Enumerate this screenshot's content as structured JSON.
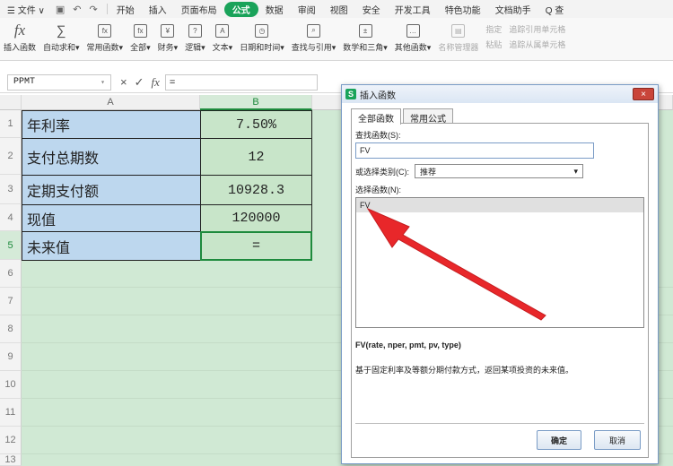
{
  "menu": {
    "file": "☰ 文件 ∨",
    "items": [
      "开始",
      "插入",
      "页面布局",
      "公式",
      "数据",
      "审阅",
      "视图",
      "安全",
      "开发工具",
      "特色功能",
      "文档助手"
    ],
    "active": "公式",
    "search": "Q 查"
  },
  "ribbon": {
    "buttons": [
      {
        "label": "插入函数",
        "icon": "fx-icon"
      },
      {
        "label": "自动求和▾",
        "icon": "sigma-icon"
      },
      {
        "label": "常用函数▾",
        "icon": "function-icon"
      },
      {
        "label": "全部▾",
        "icon": "function-icon"
      },
      {
        "label": "财务▾",
        "icon": "yen-icon"
      },
      {
        "label": "逻辑▾",
        "icon": "question-icon"
      },
      {
        "label": "文本▾",
        "icon": "text-icon"
      },
      {
        "label": "日期和时间▾",
        "icon": "clock-icon"
      },
      {
        "label": "查找与引用▾",
        "icon": "lookup-icon"
      },
      {
        "label": "数学和三角▾",
        "icon": "math-icon"
      },
      {
        "label": "其他函数▾",
        "icon": "more-icon"
      },
      {
        "label": "名称管理器",
        "icon": "name-manager-icon"
      }
    ],
    "small": [
      "指定",
      "粘贴",
      "追踪引用单元格",
      "追踪从属单元格"
    ]
  },
  "formula_bar": {
    "name_box": "PPMT",
    "cancel": "×",
    "confirm": "✓",
    "fx": "fx",
    "value": "="
  },
  "sheet": {
    "columns": [
      "A",
      "B"
    ],
    "rows": [
      "1",
      "2",
      "3",
      "4",
      "5",
      "6",
      "7",
      "8",
      "9",
      "10",
      "11",
      "12",
      "13"
    ],
    "data": [
      {
        "label": "年利率",
        "value": "7.50%"
      },
      {
        "label": "支付总期数",
        "value": "12"
      },
      {
        "label": "定期支付额",
        "value": "10928.3"
      },
      {
        "label": "现值",
        "value": "120000"
      },
      {
        "label": "未来值",
        "value": "="
      }
    ]
  },
  "dialog": {
    "title": "插入函数",
    "close": "×",
    "tabs": [
      "全部函数",
      "常用公式"
    ],
    "search_label": "查找函数(S):",
    "search_value": "FV",
    "category_label": "或选择类别(C):",
    "category_value": "推荐",
    "list_label": "选择函数(N):",
    "list_items": [
      "FV"
    ],
    "syntax": "FV(rate, nper, pmt, pv, type)",
    "description": "基于固定利率及等额分期付款方式，返回某项投资的未来值。",
    "ok": "确定",
    "cancel": "取消"
  },
  "colors": {
    "accent": "#1aa35a",
    "sheet_bg": "#d0e9d4",
    "label_cell": "#bdd7ee",
    "value_cell": "#c8e5c9",
    "arrow": "#e8272a"
  }
}
